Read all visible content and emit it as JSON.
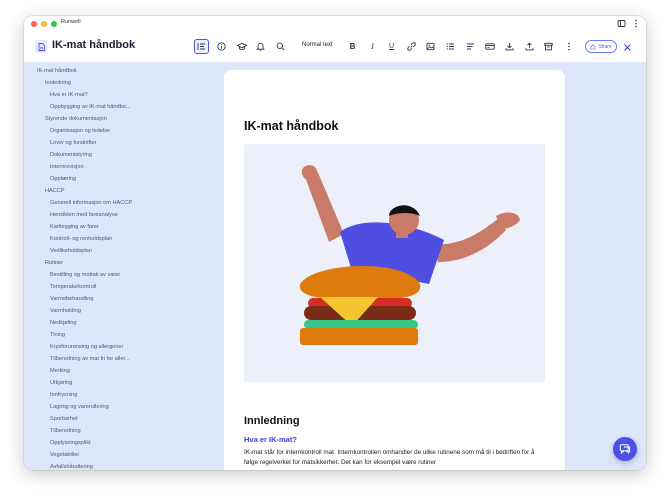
{
  "app": {
    "name": "Runwell"
  },
  "header": {
    "title": "IK-mat håndbok",
    "text_style": "Normal text",
    "share_label": "Share"
  },
  "toc": {
    "items": [
      {
        "label": "IK-mat håndbok",
        "level": 0
      },
      {
        "label": "Innledning",
        "level": 1
      },
      {
        "label": "Hva er IK-mat?",
        "level": 2
      },
      {
        "label": "Oppbygging av IK-mat håndbo...",
        "level": 2
      },
      {
        "label": "Styrende dokumentasjon",
        "level": 1
      },
      {
        "label": "Organisasjon og ledelse",
        "level": 2
      },
      {
        "label": "Lover og forskrifter",
        "level": 2
      },
      {
        "label": "Dokumentstyring",
        "level": 2
      },
      {
        "label": "Internrevisjon",
        "level": 2
      },
      {
        "label": "Opplæring",
        "level": 2
      },
      {
        "label": "HACCP",
        "level": 1
      },
      {
        "label": "Generell informasjon om HACCP",
        "level": 2
      },
      {
        "label": "Hensikten med fareanalyse",
        "level": 2
      },
      {
        "label": "Kartlegging av farer",
        "level": 2
      },
      {
        "label": "Kontroll- og renholdsplan",
        "level": 2
      },
      {
        "label": "Vedlikeholdsplan",
        "level": 2
      },
      {
        "label": "Rutiner",
        "level": 1
      },
      {
        "label": "Bestilling og mottak av varer",
        "level": 2
      },
      {
        "label": "Temperaturkontroll",
        "level": 2
      },
      {
        "label": "Varmebehandling",
        "level": 2
      },
      {
        "label": "Varmholding",
        "level": 2
      },
      {
        "label": "Nedkjøling",
        "level": 2
      },
      {
        "label": "Tining",
        "level": 2
      },
      {
        "label": "Krysforurensing og allergener",
        "level": 2
      },
      {
        "label": "Tilberedning av mat fri for aller...",
        "level": 2
      },
      {
        "label": "Merking",
        "level": 2
      },
      {
        "label": "Utkjøring",
        "level": 2
      },
      {
        "label": "Innfrysning",
        "level": 2
      },
      {
        "label": "Lagring og varerullering",
        "level": 2
      },
      {
        "label": "Sporbarhet",
        "level": 2
      },
      {
        "label": "Tilberedning",
        "level": 2
      },
      {
        "label": "Opplysningsplikt",
        "level": 2
      },
      {
        "label": "Vegetabilier",
        "level": 2
      },
      {
        "label": "Avfallshåndtering",
        "level": 2
      }
    ]
  },
  "document": {
    "title": "IK-mat håndbok",
    "section_heading": "Innledning",
    "subheading": "Hva er IK-mat?",
    "paragraph": "IK-mat står for internkontroll mat. Internkontrollen omhandler de ulike rutinene som må til i bedriften for å følge regelverket for matsikkerhet. Det kan for eksempel være rutiner"
  },
  "icons": {
    "doc": "document-icon",
    "outline": "outline-icon",
    "info": "info-icon",
    "learn": "graduation-cap-icon",
    "bell": "bell-icon",
    "search": "search-icon",
    "bold": "bold-icon",
    "italic": "italic-icon",
    "underline": "underline-icon",
    "link": "link-icon",
    "image": "image-icon",
    "list": "bullet-list-icon",
    "align": "align-icon",
    "card": "card-icon",
    "download": "download-icon",
    "upload": "upload-icon",
    "archive": "archive-icon",
    "more": "more-vertical-icon",
    "close": "close-icon",
    "chat": "chat-icon"
  },
  "colors": {
    "accent": "#4b51e8",
    "sidebar_bg": "#dde6fb",
    "subheading": "#3d3ddb",
    "illustration_shirt": "#4e4fe0",
    "illustration_bun": "#dd7c0d"
  }
}
